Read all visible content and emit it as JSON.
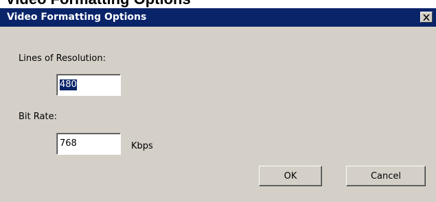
{
  "header_fragment": "Video Formatting Options",
  "dialog": {
    "title": "Video Formatting Options",
    "close_icon": "close-x-icon"
  },
  "fields": {
    "resolution_label": "Lines of Resolution:",
    "resolution_value": "480",
    "bitrate_label": "Bit Rate:",
    "bitrate_value": "768",
    "bitrate_unit": "Kbps"
  },
  "buttons": {
    "ok_label": "OK",
    "cancel_label": "Cancel"
  },
  "colors": {
    "titlebar": "#0a246a",
    "dialog_face": "#d4d0c8",
    "selection": "#0a246a"
  }
}
